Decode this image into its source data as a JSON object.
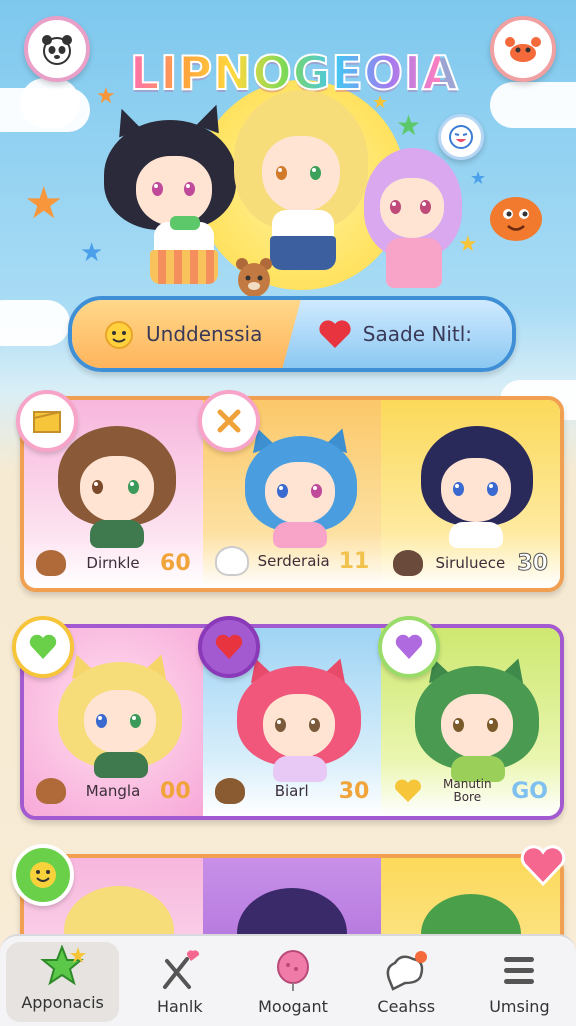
{
  "app": {
    "title": "LIPNOGEOIA"
  },
  "banner": {
    "left_label": "Unddenssia",
    "right_label": "Saade Nitl:"
  },
  "rows": [
    {
      "cards": [
        {
          "name": "Dirnkle",
          "score": "60",
          "score_color": "#f0a43a"
        },
        {
          "name": "Serderaia",
          "score": "11",
          "score_color": "#f2c24f"
        },
        {
          "name": "Siruluece",
          "score": "30",
          "score_color": "#ffffff"
        }
      ]
    },
    {
      "cards": [
        {
          "name": "Mangla",
          "score": "00",
          "score_color": "#f0a43a"
        },
        {
          "name": "Biarl",
          "score": "30",
          "score_color": "#f0a43a"
        },
        {
          "name": "Manutin Bore",
          "score": "GO",
          "score_color": "#7fc0f0"
        }
      ]
    }
  ],
  "nav": [
    {
      "label": "Apponacis",
      "icon": "star-icon",
      "active": true
    },
    {
      "label": "Hanlk",
      "icon": "wand-icon",
      "active": false
    },
    {
      "label": "Moogant",
      "icon": "balloon-icon",
      "active": false
    },
    {
      "label": "Ceahss",
      "icon": "chat-icon",
      "active": false
    },
    {
      "label": "Umsing",
      "icon": "menu-icon",
      "active": false
    }
  ],
  "colors": {
    "accent_pink": "#e9a0c8",
    "accent_blue": "#3f8fd6",
    "row_border": "#c07ed8"
  }
}
